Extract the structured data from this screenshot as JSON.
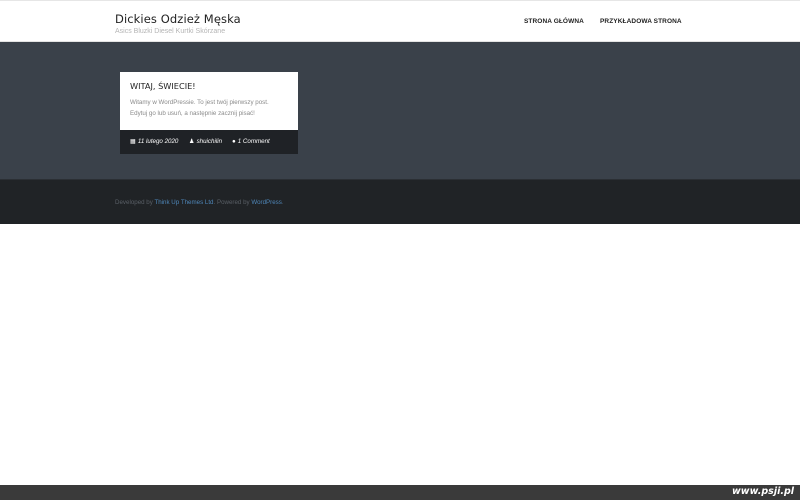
{
  "header": {
    "site_title": "Dickies Odzież Męska",
    "site_tagline": "Asics Bluzki Diesel Kurtki Skórzane",
    "nav": [
      {
        "label": "STRONA GŁÓWNA"
      },
      {
        "label": "PRZYKŁADOWA STRONA"
      }
    ]
  },
  "post": {
    "title": "WITAJ, ŚWIECIE!",
    "excerpt_line1": "Witamy w WordPressie. To jest twój pierwszy post.",
    "excerpt_line2": "Edytuj go lub usuń, a następnie zacznij pisać!",
    "date": "11 lutego 2020",
    "author": "shuichilin",
    "comments": "1 Comment",
    "icons": {
      "date": "calendar-icon",
      "author": "user-icon",
      "comments": "comments-icon"
    }
  },
  "footer": {
    "developed_by": "Developed by",
    "developer_link": "Think Up Themes Ltd",
    "powered_by": ". Powered by",
    "powered_link": "WordPress",
    "end": "."
  },
  "watermark": {
    "text": "www.psji.pl"
  },
  "colors": {
    "content_bg": "#3a414a",
    "footer_bg": "#202326",
    "meta_bg": "#1f2226",
    "link": "#4e86b8"
  }
}
